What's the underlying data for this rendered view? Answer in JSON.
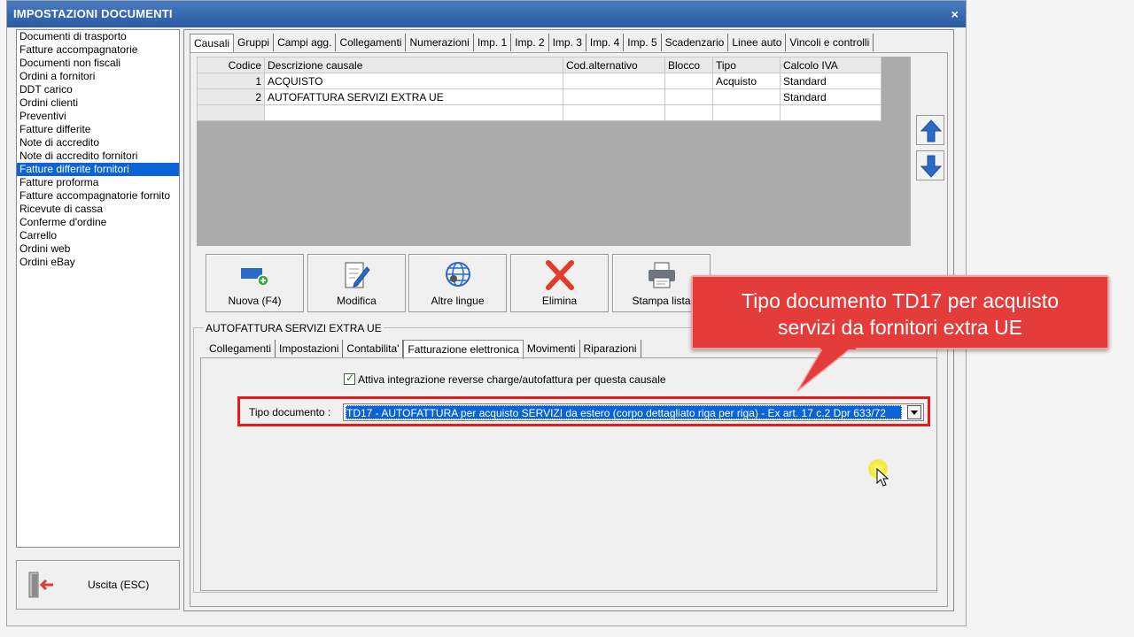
{
  "window": {
    "title": "IMPOSTAZIONI DOCUMENTI",
    "close_glyph": "×"
  },
  "doc_list": [
    "Documenti di trasporto",
    "Fatture accompagnatorie",
    "Documenti non fiscali",
    "Ordini a fornitori",
    "DDT carico",
    "Ordini clienti",
    "Preventivi",
    "Fatture differite",
    "Note di accredito",
    "Note di accredito fornitori",
    "Fatture differite fornitori",
    "Fatture proforma",
    "Fatture accompagnatorie fornito",
    "Ricevute di cassa",
    "Conferme d'ordine",
    "Carrello",
    "Ordini web",
    "Ordini eBay"
  ],
  "doc_list_selected": "Fatture differite fornitori",
  "exit_button": {
    "label": "Uscita (ESC)",
    "icon": "exit-door-icon"
  },
  "top_tabs": [
    "Causali",
    "Gruppi",
    "Campi agg.",
    "Collegamenti",
    "Numerazioni",
    "Imp. 1",
    "Imp. 2",
    "Imp. 3",
    "Imp. 4",
    "Imp. 5",
    "Scadenzario",
    "Linee auto",
    "Vincoli e controlli"
  ],
  "top_tab_active": "Causali",
  "grid": {
    "columns": [
      "Codice",
      "Descrizione causale",
      "Cod.alternativo",
      "Blocco",
      "Tipo",
      "Calcolo IVA"
    ],
    "rows": [
      [
        "1",
        "ACQUISTO",
        "",
        "",
        "Acquisto",
        "Standard"
      ],
      [
        "2",
        "AUTOFATTURA SERVIZI EXTRA UE",
        "",
        "",
        "",
        "Standard"
      ],
      [
        "",
        "",
        "",
        "",
        "",
        ""
      ]
    ]
  },
  "toolbar": {
    "new": "Nuova (F4)",
    "edit": "Modifica",
    "languages": "Altre lingue",
    "delete": "Elimina",
    "print": "Stampa lista"
  },
  "group_title": "AUTOFATTURA SERVIZI EXTRA UE",
  "sub_tabs": [
    "Collegamenti",
    "Impostazioni",
    "Contabilita'",
    "Fatturazione elettronica",
    "Movimenti",
    "Riparazioni"
  ],
  "sub_tab_active": "Fatturazione elettronica",
  "reverse_charge_checkbox": {
    "label": "Attiva integrazione reverse charge/autofattura per questa causale",
    "checked": true
  },
  "tipo_documento": {
    "label": "Tipo documento :",
    "value": "TD17 - AUTOFATTURA per acquisto SERVIZI da estero (corpo dettagliato riga per riga) - Ex art. 17 c.2 Dpr 633/72"
  },
  "callout": {
    "line1": "Tipo documento TD17 per acquisto",
    "line2": "servizi da fornitori extra UE"
  },
  "colors": {
    "titlebar": "#2a5aa3",
    "selection": "#0a64d8",
    "callout": "#e43b3b",
    "highlight_frame": "#e21b1b"
  }
}
